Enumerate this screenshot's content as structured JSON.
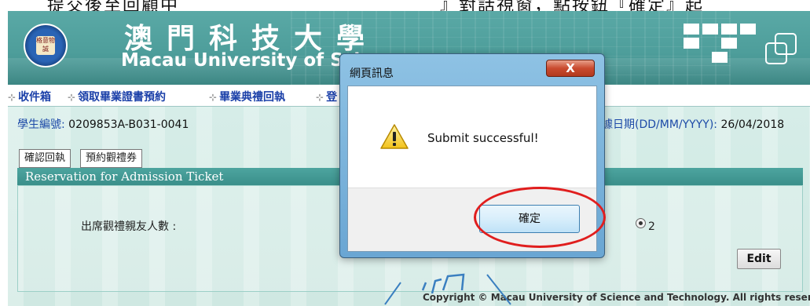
{
  "instruction": {
    "left": "提交後至回顧中",
    "right": "』對話視窗，點按鈕『確定』起"
  },
  "header": {
    "title_zh": "澳門科技大學",
    "title_en": "Macau University of Scie",
    "logo_text": "格意物誠"
  },
  "nav": {
    "items": [
      {
        "label": "收件箱"
      },
      {
        "label": "領取畢業證書預約"
      },
      {
        "label": "畢業典禮回執"
      },
      {
        "label": "登"
      }
    ]
  },
  "student": {
    "id_label": "學生編號:",
    "id_value": "0209853A-B031-0041",
    "date_label": "據日期(DD/MM/YYYY):",
    "date_value": "26/04/2018"
  },
  "tabs": [
    {
      "label": "確認回執"
    },
    {
      "label": "預約觀禮券"
    }
  ],
  "section": {
    "title": "Reservation for Admission Ticket",
    "attend_label": "出席觀禮親友人數 :",
    "radio_value": "2",
    "edit_label": "Edit"
  },
  "footer": {
    "copyright": "Copyright © Macau University of Science and Technology. All rights reserved."
  },
  "dialog": {
    "title": "網頁訊息",
    "close_label": "X",
    "message": "Submit successful!",
    "ok_label": "確定"
  },
  "colors": {
    "banner": "#4e9e9b",
    "nav_link": "#1a3fa8",
    "highlight": "#e01e1e"
  }
}
